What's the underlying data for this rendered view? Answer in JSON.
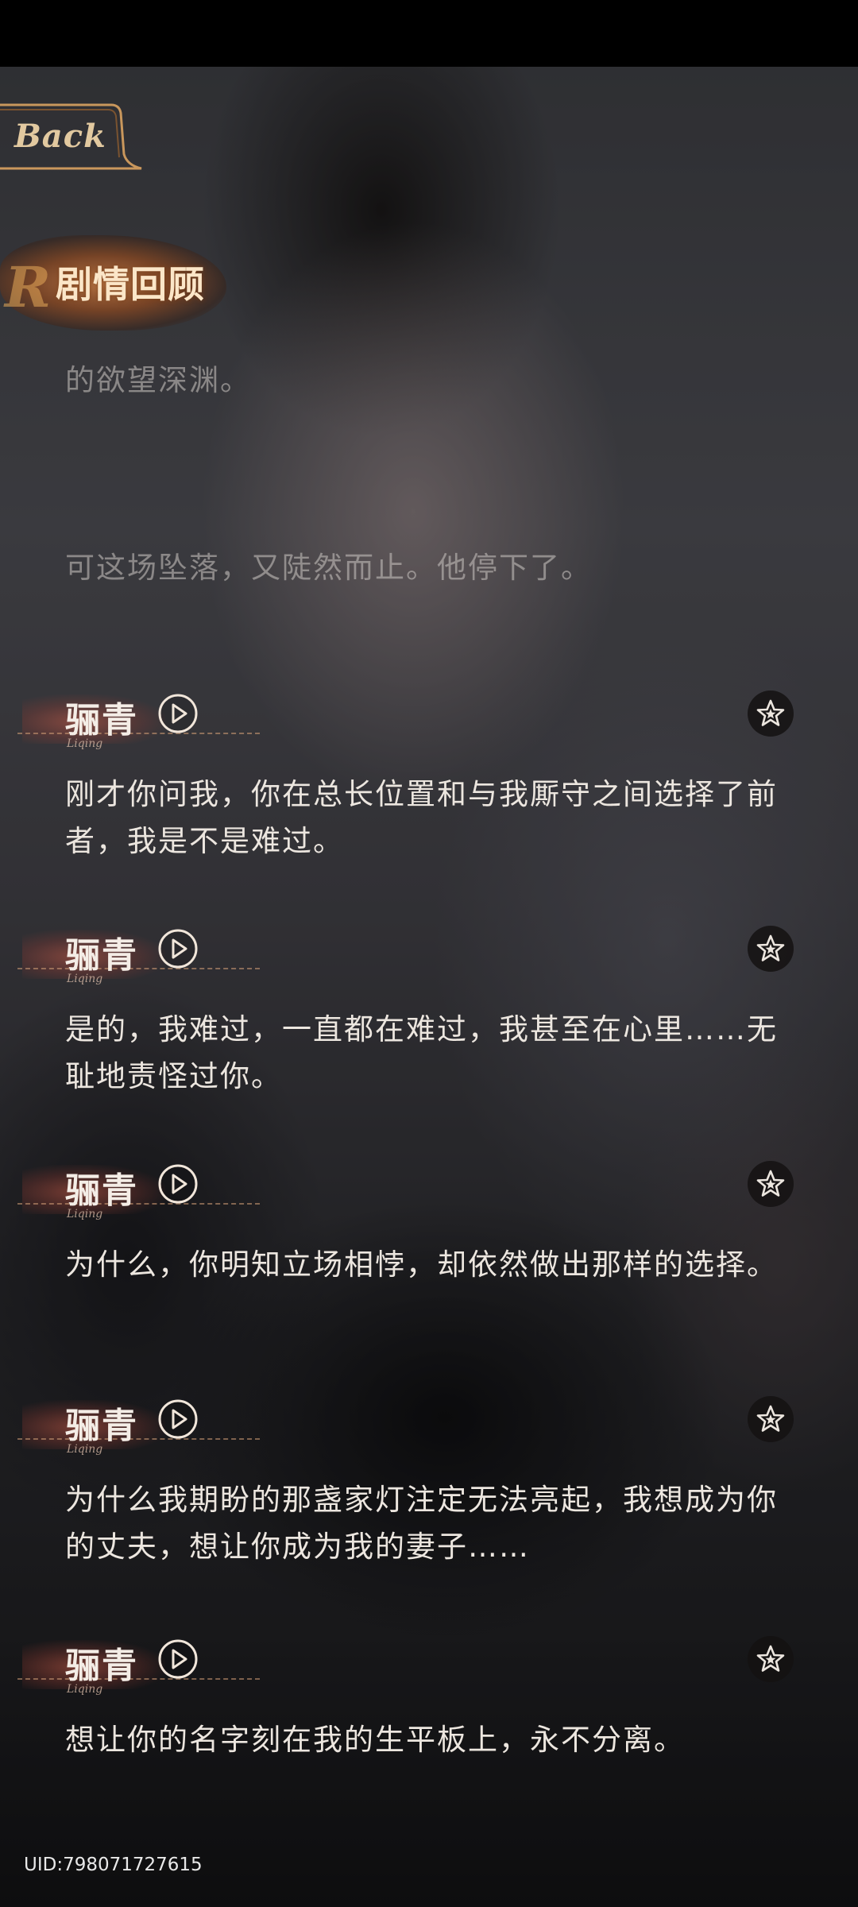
{
  "header": {
    "back_label": "Back",
    "title": "剧情回顾"
  },
  "narration": [
    "的欲望深渊。",
    "可这场坠落，又陡然而止。他停下了。"
  ],
  "dialogue": [
    {
      "speaker": "骊青",
      "speaker_roman": "Liqing",
      "text": "刚才你问我，你在总长位置和与我厮守之间选择了前者，我是不是难过。"
    },
    {
      "speaker": "骊青",
      "speaker_roman": "Liqing",
      "text": "是的，我难过，一直都在难过，我甚至在心里……无耻地责怪过你。"
    },
    {
      "speaker": "骊青",
      "speaker_roman": "Liqing",
      "text": "为什么，你明知立场相悖，却依然做出那样的选择。"
    },
    {
      "speaker": "骊青",
      "speaker_roman": "Liqing",
      "text": "为什么我期盼的那盏家灯注定无法亮起，我想成为你的丈夫，想让你成为我的妻子……"
    },
    {
      "speaker": "骊青",
      "speaker_roman": "Liqing",
      "text": "想让你的名字刻在我的生平板上，永不分离。"
    }
  ],
  "footer": {
    "uid": "UID:798071727615"
  }
}
